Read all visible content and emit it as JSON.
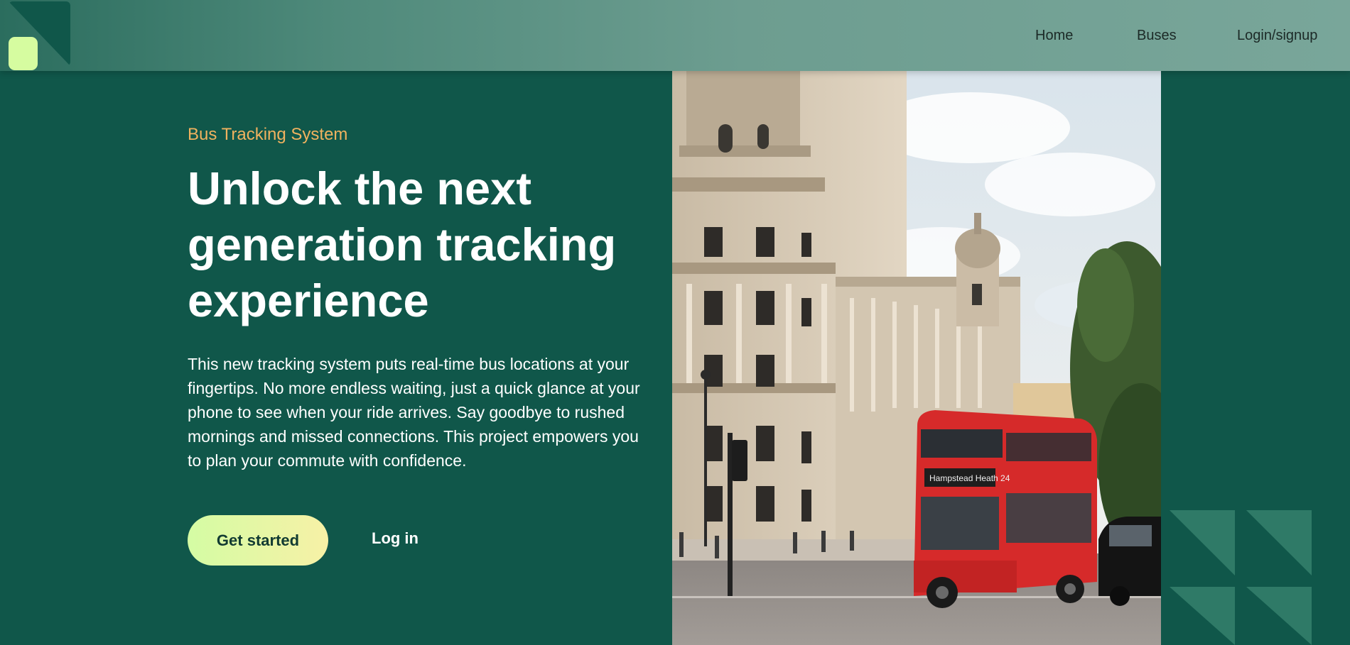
{
  "nav": {
    "links": [
      "Home",
      "Buses",
      "Login/signup"
    ]
  },
  "hero": {
    "eyebrow": "Bus Tracking System",
    "headline": "Unlock the next generation tracking experience",
    "description": "This new tracking system puts real-time bus locations at your fingertips. No more endless waiting, just a quick glance at your phone to see when your ride arrives. Say goodbye to rushed mornings and missed connections. This project empowers you to plan your commute with confidence.",
    "primary_button": "Get started",
    "secondary_button": "Log in"
  },
  "colors": {
    "background": "#10574a",
    "accent_lime": "#d6fca0",
    "eyebrow_orange": "#f0b25f",
    "bus_red": "#d62a2a"
  },
  "icons": [
    "logo-mark",
    "decorative-triangles"
  ]
}
